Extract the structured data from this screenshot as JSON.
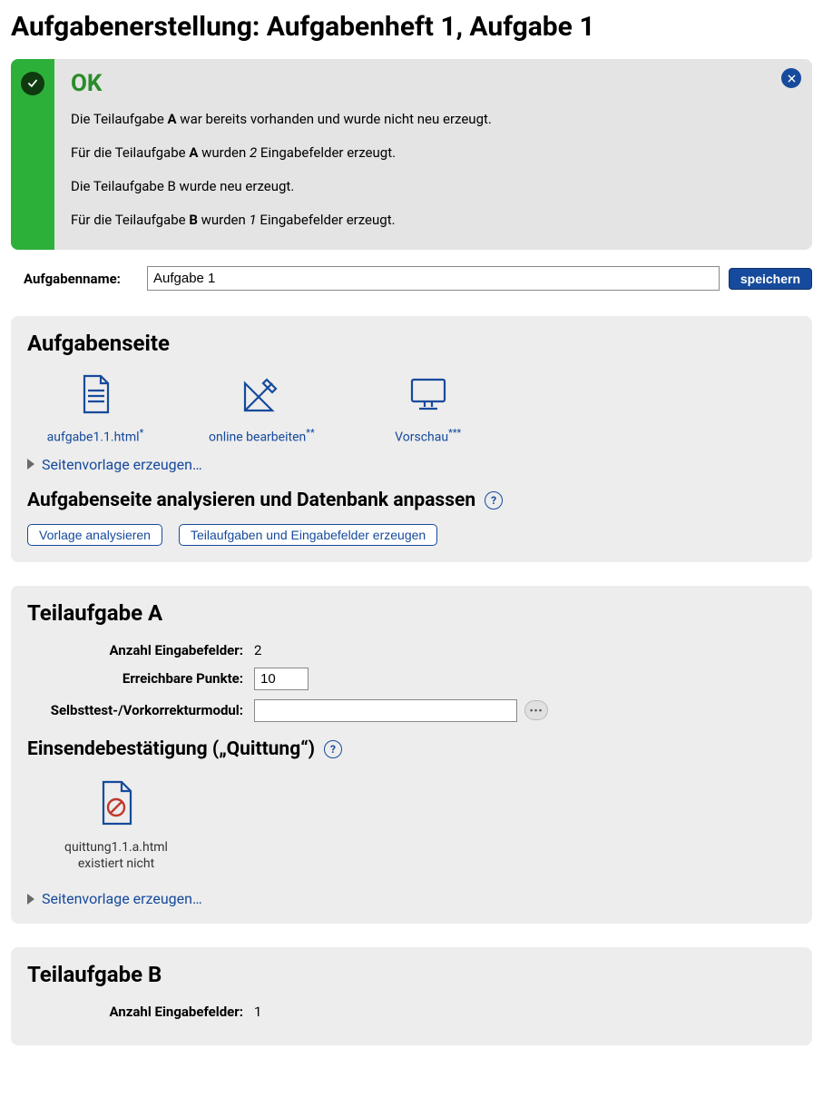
{
  "page_title": "Aufgabenerstellung: Aufgabenheft 1, Aufgabe 1",
  "alert": {
    "title": "OK",
    "lines": {
      "l1a": "Die Teilaufgabe ",
      "l1b": "A",
      "l1c": " war bereits vorhanden und wurde nicht neu erzeugt.",
      "l2a": "Für die Teilaufgabe ",
      "l2b": "A",
      "l2c": " wurden ",
      "l2d": "2",
      "l2e": " Eingabefelder erzeugt.",
      "l3": "Die Teilaufgabe B wurde neu erzeugt.",
      "l4a": "Für die Teilaufgabe ",
      "l4b": "B",
      "l4c": " wurden ",
      "l4d": "1",
      "l4e": " Eingabefelder erzeugt."
    }
  },
  "name_row": {
    "label": "Aufgabenname:",
    "value": "Aufgabe 1",
    "save": "speichern"
  },
  "aufgabenseite": {
    "title": "Aufgabenseite",
    "html_link": "aufgabe1.1.html",
    "html_sup": "*",
    "edit_link": "online bearbeiten",
    "edit_sup": "**",
    "preview_link": "Vorschau",
    "preview_sup": "***",
    "gen_template": "Seitenvorlage erzeugen…",
    "analyze_heading": "Aufgabenseite analysieren und Datenbank anpassen",
    "btn_analyze": "Vorlage analysieren",
    "btn_create": "Teilaufgaben und Eingabefelder erzeugen"
  },
  "teil_a": {
    "title": "Teilaufgabe A",
    "fields_lbl": "Anzahl Eingabefelder:",
    "fields_val": "2",
    "points_lbl": "Erreichbare Punkte:",
    "points_val": "10",
    "module_lbl": "Selbsttest-/Vorkorrekturmodul:",
    "module_val": "",
    "receipt_heading": "Einsendebestätigung („Quittung“)",
    "receipt_file": "quittung1.1.a.html",
    "receipt_missing": "existiert nicht",
    "gen_template": "Seitenvorlage erzeugen…"
  },
  "teil_b": {
    "title": "Teilaufgabe B",
    "fields_lbl": "Anzahl Eingabefelder:",
    "fields_val": "1"
  },
  "help": "?"
}
